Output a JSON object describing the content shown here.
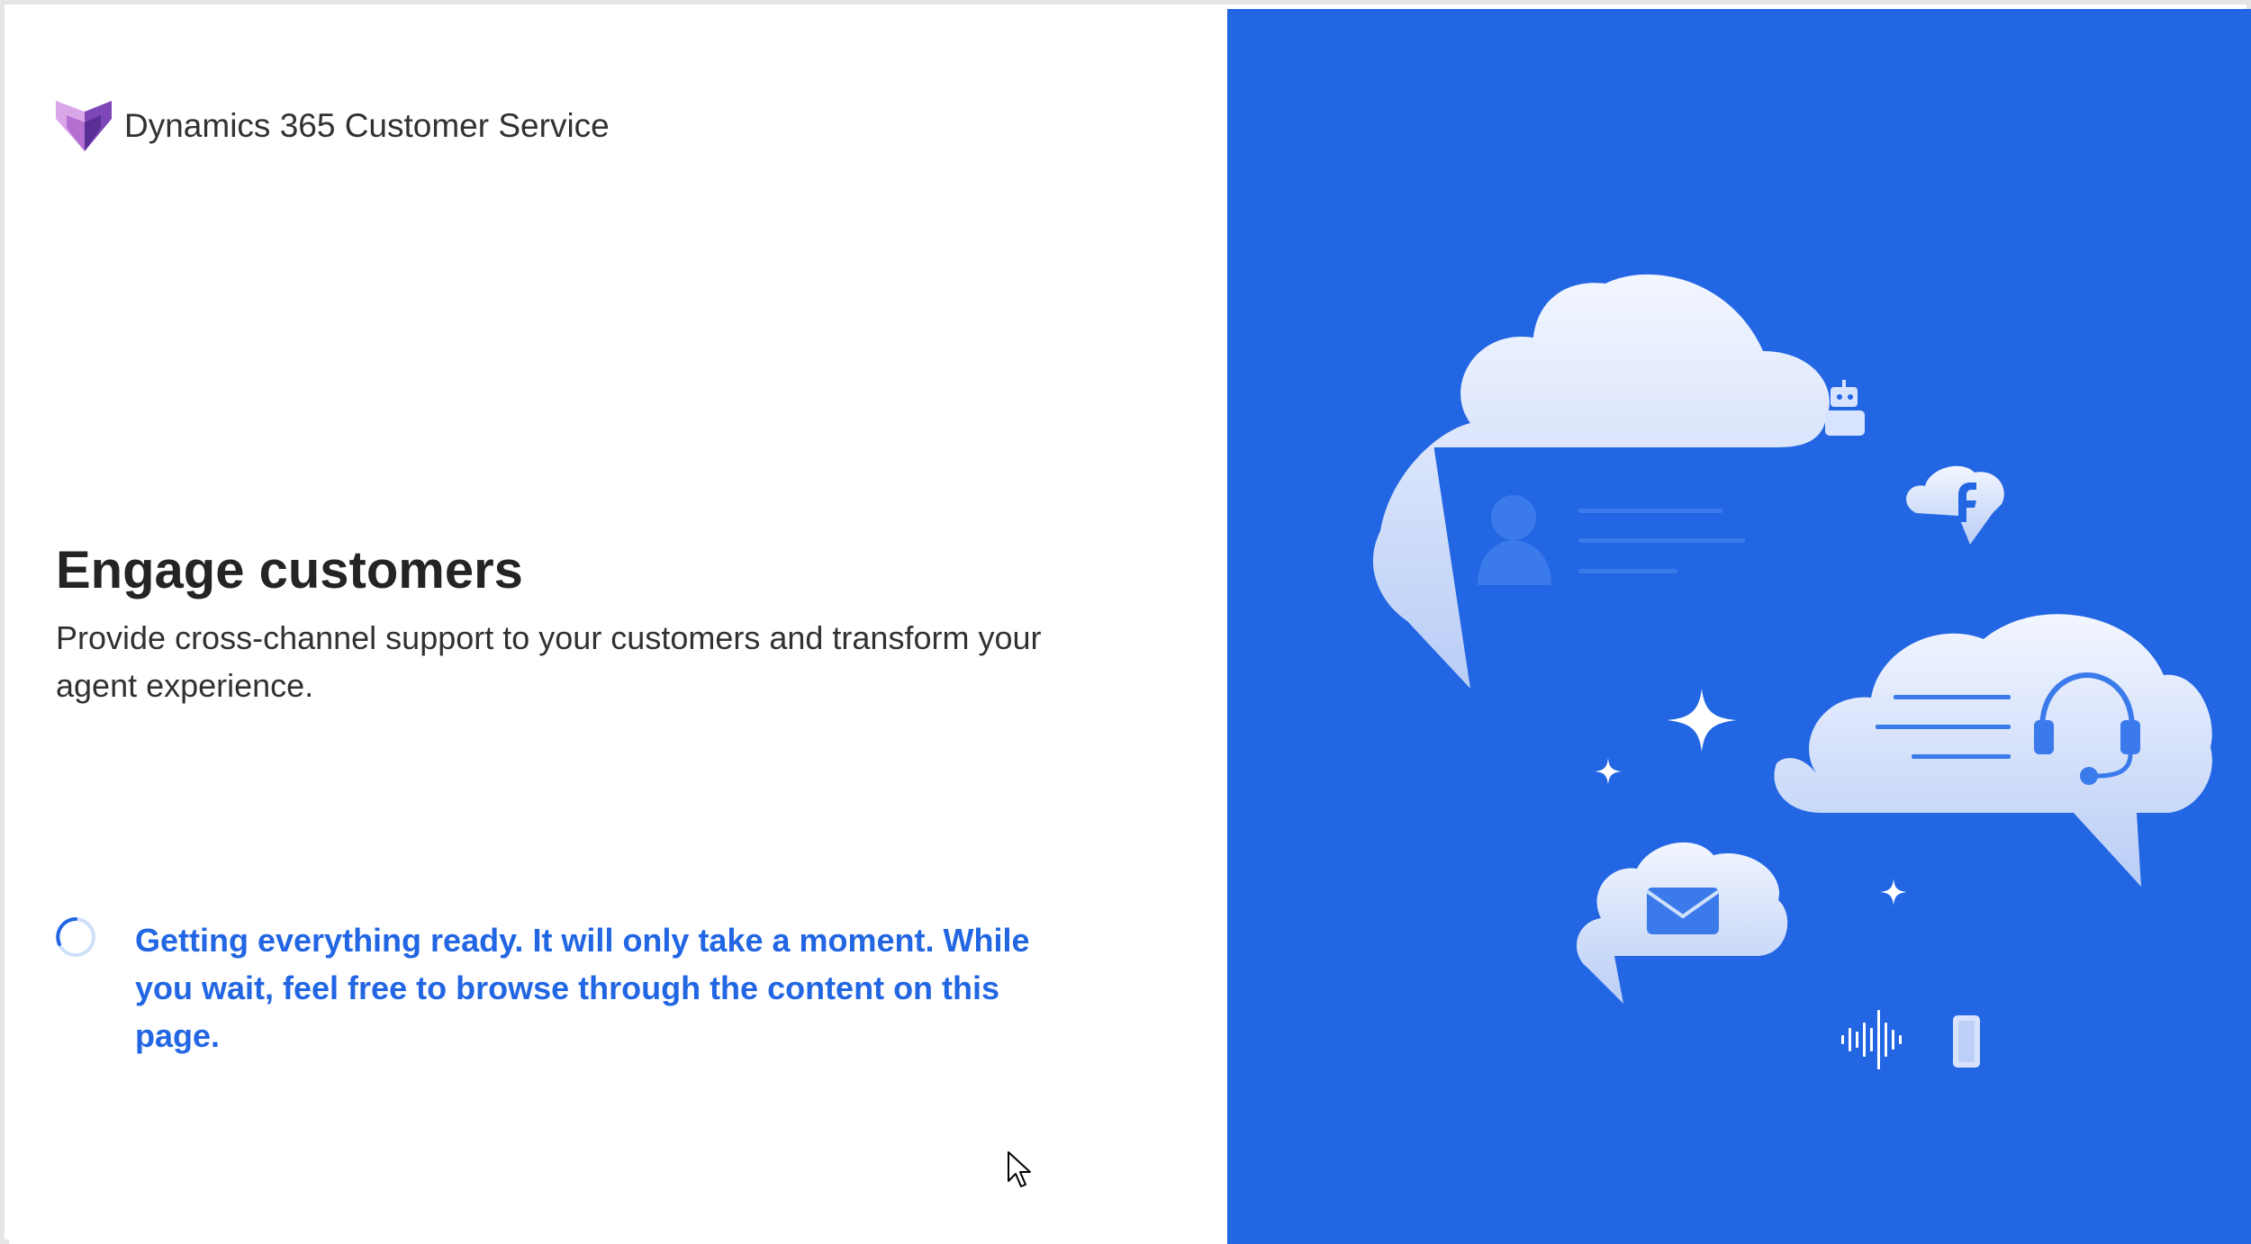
{
  "app": {
    "product_name": "Dynamics 365 Customer Service"
  },
  "hero": {
    "title": "Engage customers",
    "subtitle": "Provide cross-channel support to your customers and transform your agent experience."
  },
  "loading": {
    "message": "Getting everything ready. It will only take a moment. While you wait, feel free to browse through the content on this page."
  },
  "illustration": {
    "icons": [
      "chat-cloud-icon",
      "person-icon",
      "headset-icon",
      "bot-icon",
      "facebook-icon",
      "mail-icon",
      "voice-wave-icon",
      "mobile-phone-icon",
      "sparkle-icon"
    ]
  },
  "colors": {
    "accent": "#2266e3",
    "heading": "#242424",
    "body_text": "#323130",
    "cloud": "#e6eeff",
    "logo_light": "#c98ddb",
    "logo_dark": "#6b3fa8"
  }
}
